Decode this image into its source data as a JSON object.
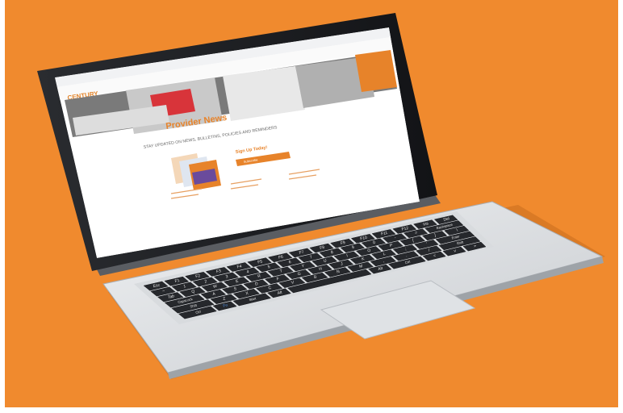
{
  "scene": {
    "background_color": "#f08a2e",
    "object": "laptop"
  },
  "webpage": {
    "logo": "CENTURY",
    "banner_title": "Provider News",
    "headline": "STAY UPDATED ON NEWS, BULLETINS, POLICIES AND REMINDERS",
    "signup_title": "Sign Up Today!",
    "signup_button": "Subscribe"
  },
  "keyboard": {
    "row1": [
      "Esc",
      "F1",
      "F2",
      "F3",
      "F4",
      "F5",
      "F6",
      "F7",
      "F8",
      "F9",
      "F10",
      "F11",
      "F12",
      "Ins",
      "Del"
    ],
    "row2": [
      "~",
      "1",
      "2",
      "3",
      "4",
      "5",
      "6",
      "7",
      "8",
      "9",
      "0",
      "-",
      "=",
      "Backspace"
    ],
    "row3": [
      "Tab",
      "Q",
      "W",
      "E",
      "R",
      "T",
      "Y",
      "U",
      "I",
      "O",
      "P",
      "[",
      "]",
      "\\"
    ],
    "row4": [
      "CapsLock",
      "A",
      "S",
      "D",
      "F",
      "G",
      "H",
      "J",
      "K",
      "L",
      ";",
      "'",
      "Enter"
    ],
    "row5": [
      "Shift",
      "Z",
      "X",
      "C",
      "V",
      "B",
      "N",
      "M",
      ",",
      ".",
      "/",
      "Shift"
    ],
    "row6": [
      "Ctrl",
      "Fn",
      "Start",
      "Alt",
      "",
      "Alt",
      "Ctrl",
      "<",
      "v",
      ">"
    ]
  }
}
